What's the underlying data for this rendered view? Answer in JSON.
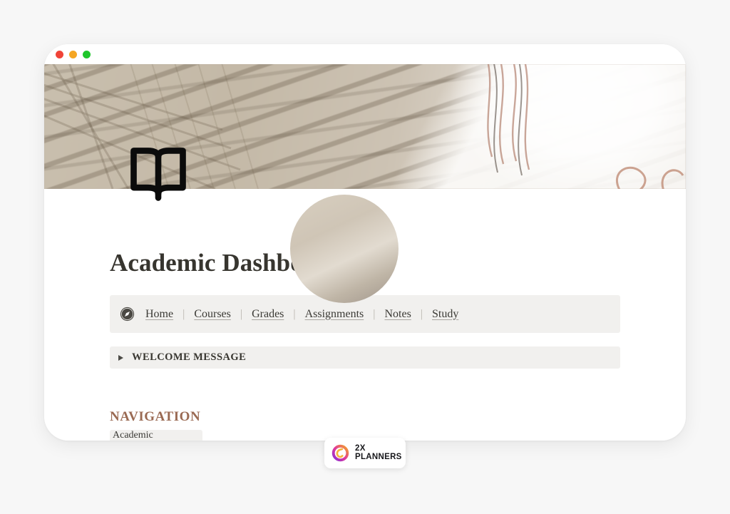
{
  "window": {
    "traffic_lights": [
      {
        "name": "close",
        "color": "#f04438"
      },
      {
        "name": "minimize",
        "color": "#f5a623"
      },
      {
        "name": "maximize",
        "color": "#1fc62b"
      }
    ]
  },
  "cover": {
    "icon": "open-book-icon",
    "description": "palm frond shadows on beige wall"
  },
  "page": {
    "title": "Academic Dashboard"
  },
  "nav_callout": {
    "icon": "compass-icon",
    "separator": "|",
    "links": [
      {
        "label": "Home"
      },
      {
        "label": "Courses"
      },
      {
        "label": "Grades"
      },
      {
        "label": "Assignments"
      },
      {
        "label": "Notes"
      },
      {
        "label": "Study"
      }
    ]
  },
  "toggle": {
    "label": "WELCOME MESSAGE",
    "expanded": false
  },
  "navigation_section": {
    "heading": "NAVIGATION",
    "row_label": "Academic"
  },
  "watermark": {
    "line1": "2X",
    "line2": "PLANNERS",
    "logo": "gradient-ring-logo",
    "colors": {
      "start": "#8b2fd6",
      "mid": "#e0399b",
      "end": "#f5a623"
    }
  }
}
